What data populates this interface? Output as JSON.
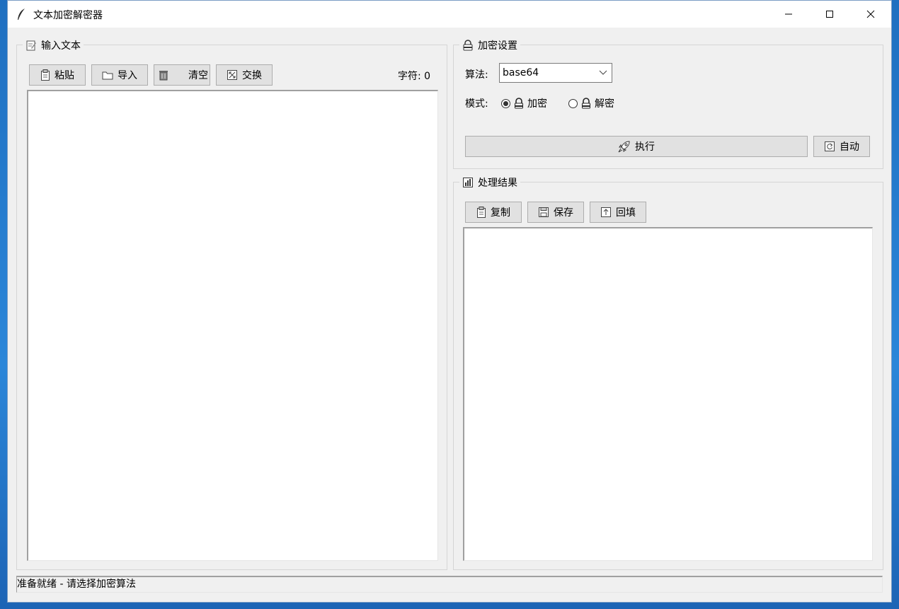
{
  "window": {
    "title": "文本加密解密器"
  },
  "input_panel": {
    "title": "输入文本",
    "paste_label": "粘贴",
    "import_label": "导入",
    "clear_label": "清空",
    "swap_label": "交换",
    "char_count": "字符: 0"
  },
  "settings_panel": {
    "title": "加密设置",
    "algorithm_label": "算法:",
    "algorithm_value": "base64",
    "mode_label": "模式:",
    "encrypt_label": "加密",
    "decrypt_label": "解密",
    "selected_mode": "encrypt",
    "execute_label": "执行",
    "auto_label": "自动"
  },
  "result_panel": {
    "title": "处理结果",
    "copy_label": "复制",
    "save_label": "保存",
    "fill_back_label": "回填"
  },
  "status_bar": {
    "text": "准备就绪 - 请选择加密算法"
  }
}
